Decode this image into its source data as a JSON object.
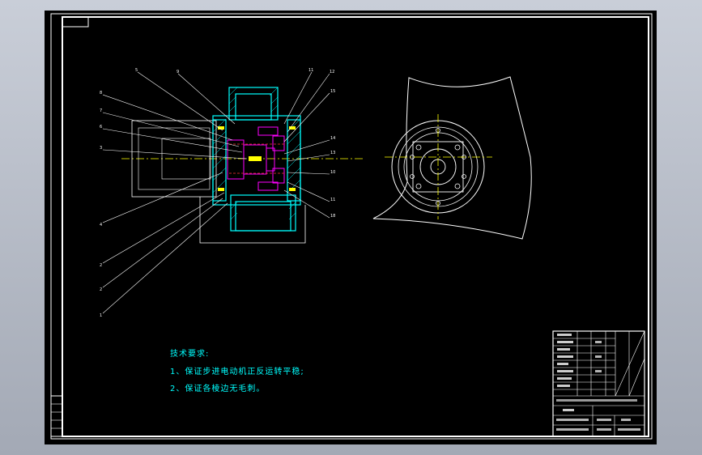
{
  "notes": {
    "heading": "技术要求:",
    "items": [
      "1、保证步进电动机正反运转平稳;",
      "2、保证各棱边无毛刺。"
    ]
  },
  "callouts": {
    "left": [
      "5",
      "9",
      "8",
      "7",
      "6",
      "3",
      "4",
      "2",
      "2",
      "1"
    ],
    "right": [
      "11",
      "12",
      "15",
      "14",
      "13",
      "10",
      "11",
      "18"
    ]
  },
  "colors": {
    "background": "#000000",
    "outline": "#ffffff",
    "section": "#00ffff",
    "parts": "#ff00ff",
    "center": "#ffff00",
    "hidden": "#ff3333"
  }
}
